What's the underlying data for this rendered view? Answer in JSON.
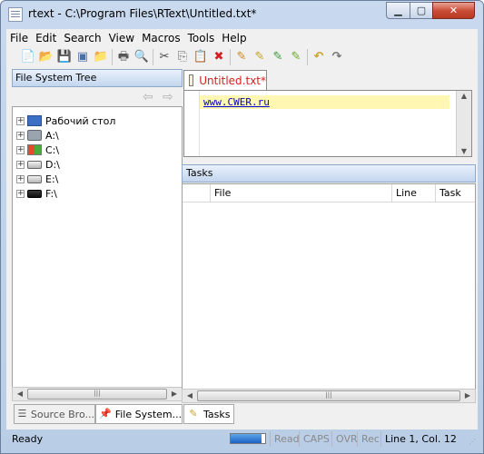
{
  "window": {
    "title": "rtext - C:\\Program Files\\RText\\Untitled.txt*",
    "minimize_glyph": "▁",
    "maximize_glyph": "▢",
    "close_glyph": "✕"
  },
  "menu": [
    "File",
    "Edit",
    "Search",
    "View",
    "Macros",
    "Tools",
    "Help"
  ],
  "toolbar_icons": [
    {
      "name": "new-file-icon",
      "glyph": "📄"
    },
    {
      "name": "open-folder-icon",
      "glyph": "📂"
    },
    {
      "name": "save-icon",
      "glyph": "💾"
    },
    {
      "name": "save-all-icon",
      "glyph": "▣"
    },
    {
      "name": "folder-icon",
      "glyph": "📁"
    },
    {
      "name": "print-icon",
      "glyph": "🖶"
    },
    {
      "name": "print-preview-icon",
      "glyph": "🔍"
    },
    {
      "name": "cut-icon",
      "glyph": "✂"
    },
    {
      "name": "copy-icon",
      "glyph": "⎘"
    },
    {
      "name": "paste-icon",
      "glyph": "📋"
    },
    {
      "name": "delete-icon",
      "glyph": "✖"
    },
    {
      "name": "find-icon",
      "glyph": "✎"
    },
    {
      "name": "find-next-icon",
      "glyph": "✎"
    },
    {
      "name": "replace-icon",
      "glyph": "✎"
    },
    {
      "name": "replace-all-icon",
      "glyph": "✎"
    },
    {
      "name": "undo-icon",
      "glyph": "↶"
    },
    {
      "name": "redo-icon",
      "glyph": "↷"
    }
  ],
  "left_panel": {
    "title": "File System Tree",
    "back_glyph": "⇦",
    "forward_glyph": "⇨",
    "tree": [
      {
        "label": "Рабочий стол",
        "icon": "desktop"
      },
      {
        "label": "A:\\",
        "icon": "floppy"
      },
      {
        "label": "C:\\",
        "icon": "win"
      },
      {
        "label": "D:\\",
        "icon": "drive"
      },
      {
        "label": "E:\\",
        "icon": "drive"
      },
      {
        "label": "F:\\",
        "icon": "usb"
      }
    ],
    "tabs": [
      {
        "label": "Source Bro...",
        "icon": "list-icon",
        "glyph": "☰"
      },
      {
        "label": "File System...",
        "icon": "pin-icon",
        "glyph": "📌"
      }
    ]
  },
  "editor": {
    "tab_label": "Untitled.txt*",
    "content": "www.CWER.ru"
  },
  "tasks": {
    "title": "Tasks",
    "columns": [
      "File",
      "Line",
      "Task"
    ],
    "tab_label": "Tasks",
    "tab_glyph": "✎"
  },
  "status": {
    "text": "Ready",
    "progress": 0.9,
    "fields": [
      "Read",
      "CAPS",
      "OVR",
      "Rec"
    ],
    "position": "Line 1, Col. 12"
  },
  "colors": {
    "accent_header": "#c3d6ee",
    "modified_tab": "#d42020",
    "current_line": "#fff7b2",
    "link": "#0000cc"
  }
}
